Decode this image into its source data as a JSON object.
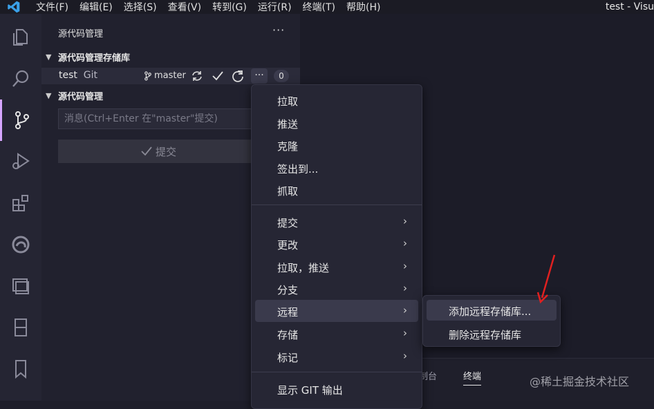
{
  "window_title": "test - Visu",
  "menubar": [
    "文件(F)",
    "编辑(E)",
    "选择(S)",
    "查看(V)",
    "转到(G)",
    "运行(R)",
    "终端(T)",
    "帮助(H)"
  ],
  "activity_icons": [
    "explorer-icon",
    "search-icon",
    "source-control-icon",
    "run-debug-icon",
    "extensions-icon",
    "edge-icon",
    "remote-explorer-icon",
    "device-icon",
    "bookmark-icon"
  ],
  "sidebar": {
    "title": "源代码管理",
    "more": "···",
    "repos_section": "源代码管理存储库",
    "repo": {
      "name": "test",
      "type": "Git",
      "branch": "master",
      "more": "···",
      "badge": "0"
    },
    "scm_section": "源代码管理",
    "message_placeholder": "消息(Ctrl+Enter 在\"master\"提交)",
    "commit_label": "提交"
  },
  "context_menu": {
    "group1": [
      "拉取",
      "推送",
      "克隆",
      "签出到...",
      "抓取"
    ],
    "group2": [
      "提交",
      "更改",
      "拉取，推送",
      "分支",
      "远程",
      "存储",
      "标记"
    ],
    "group3": [
      "显示 GIT 输出"
    ],
    "highlighted": "远程",
    "arrow": "›"
  },
  "submenu": {
    "items": [
      "添加远程存储库...",
      "删除远程存储库"
    ],
    "highlighted": "添加远程存储库..."
  },
  "panel": {
    "tabs": [
      "制台",
      "终端"
    ],
    "active": "终端"
  },
  "watermark": "@稀土掘金技术社区",
  "colors": {
    "accent": "#d6a6ff",
    "annotation_arrow": "#e02020"
  }
}
